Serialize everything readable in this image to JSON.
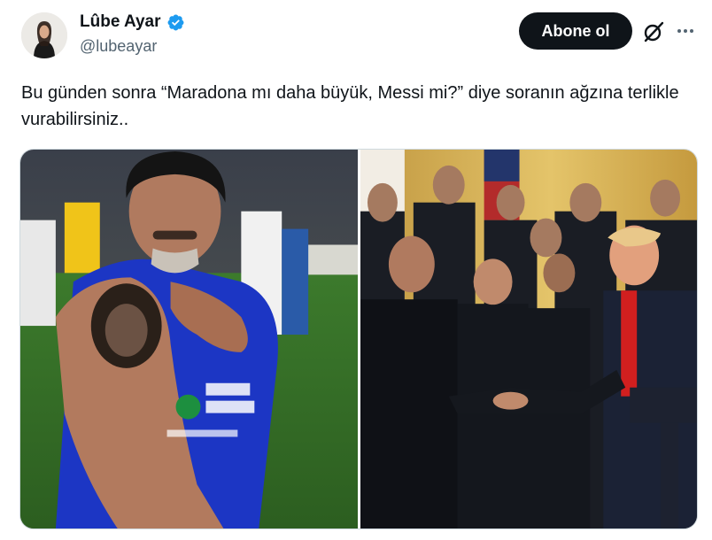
{
  "author": {
    "name": "Lûbe Ayar",
    "handle": "@lubeayar",
    "verified_badge_icon": "verified-badge-icon",
    "badge_color": "#1d9bf0"
  },
  "actions": {
    "follow_label": "Abone ol",
    "grok_icon": "grok-icon",
    "more_icon": "more-icon"
  },
  "tweet": {
    "text": "Bu günden sonra “Maradona mı daha büyük, Messi mi?” diye soranın ağzına terlikle vurabilirsiniz.."
  },
  "media": {
    "photos": [
      {
        "icon": "photo-player-tattoo"
      },
      {
        "icon": "photo-team-handshake"
      }
    ]
  },
  "colors": {
    "text_primary": "#0f1419",
    "text_secondary": "#536471",
    "button_bg": "#0f1419",
    "border": "#cfd9de"
  }
}
